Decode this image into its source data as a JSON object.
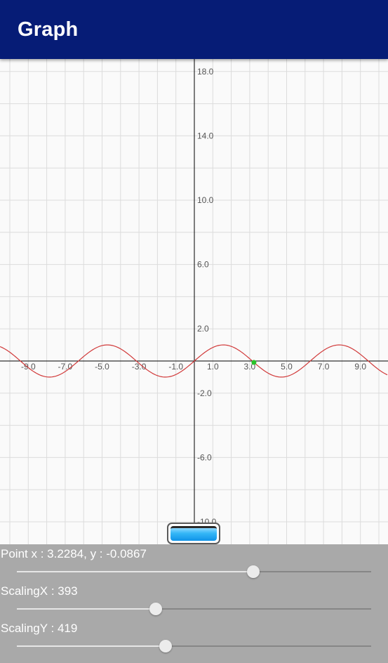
{
  "app_bar": {
    "title": "Graph"
  },
  "graph": {
    "x_tick_labels": [
      "-9.0",
      "-7.0",
      "-5.0",
      "-3.0",
      "-1.0",
      "1.0",
      "3.0",
      "5.0",
      "7.0",
      "9.0"
    ],
    "y_tick_labels": [
      "18.0",
      "14.0",
      "10.0",
      "6.0",
      "2.0",
      "-2.0",
      "-6.0",
      "-10.0"
    ],
    "x_tick_values": [
      -9,
      -7,
      -5,
      -3,
      -1,
      1,
      3,
      5,
      7,
      9
    ],
    "y_tick_values": [
      18,
      14,
      10,
      6,
      2,
      -2,
      -6,
      -10
    ],
    "curve_color": "#d13a3a",
    "point_color": "#2bc42b",
    "grid_color": "#dcdcdc",
    "axis_color": "#000000"
  },
  "chart_data": {
    "type": "line",
    "function": "sin(x)",
    "xlim": [
      -10.5,
      10.5
    ],
    "ylim": [
      -10.0,
      18.8
    ],
    "grid": true,
    "series": [
      {
        "x_range": [
          -10.5,
          10.5
        ],
        "amplitude": 1,
        "period": 6.2832
      }
    ],
    "marked_point": {
      "x": 3.2284,
      "y": -0.0867
    }
  },
  "controls": {
    "point_label": "Point x : 3.2284, y : -0.0867",
    "point_slider_value": 0.667,
    "scaling_x_label": "ScalingX : 393",
    "scaling_x_value": 0.393,
    "scaling_y_label": "ScalingY : 419",
    "scaling_y_value": 0.419
  }
}
